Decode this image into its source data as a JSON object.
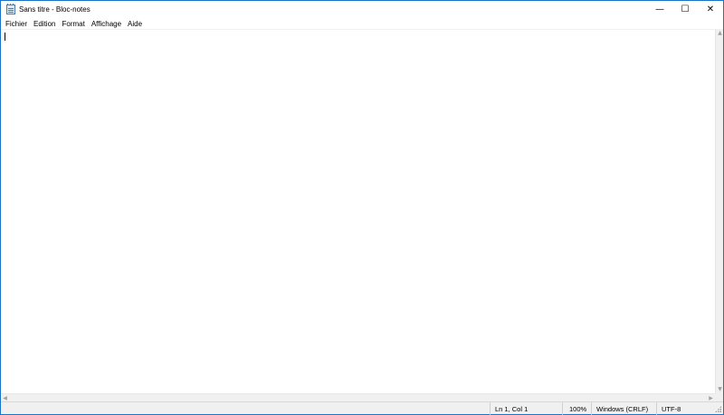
{
  "window": {
    "title": "Sans titre - Bloc-notes",
    "controls": {
      "minimize": "—",
      "maximize": "☐",
      "close": "✕"
    }
  },
  "menu": {
    "items": [
      "Fichier",
      "Edition",
      "Format",
      "Affichage",
      "Aide"
    ]
  },
  "editor": {
    "content": ""
  },
  "scrollbars": {
    "up": "▲",
    "down": "▼",
    "left": "◀",
    "right": "▶"
  },
  "status": {
    "position": "Ln 1, Col 1",
    "zoom": "100%",
    "line_ending": "Windows (CRLF)",
    "encoding": "UTF-8"
  },
  "colors": {
    "window_border": "#1a73c7",
    "status_bg": "#f0f0f0"
  }
}
